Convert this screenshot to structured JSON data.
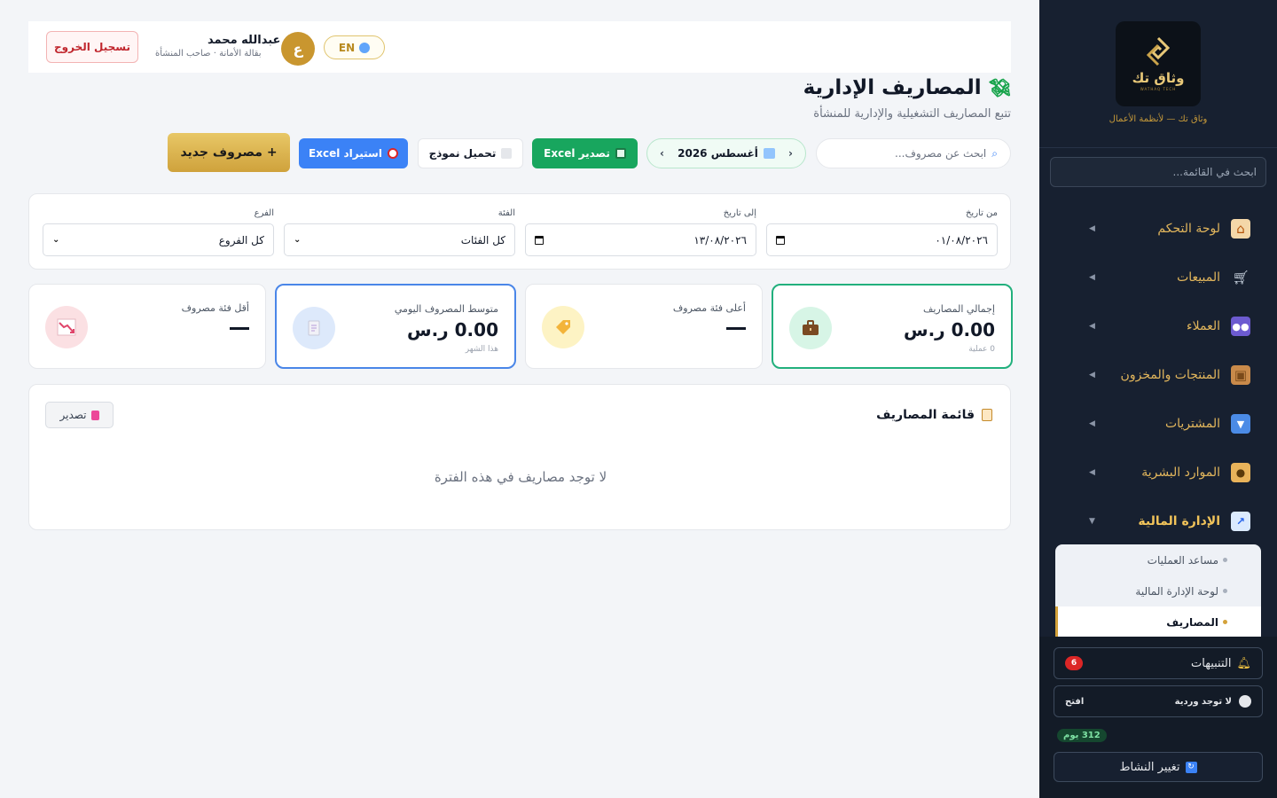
{
  "sidebar": {
    "logo_name": "وثاق تك",
    "logo_sub": "WATHAQ TECH",
    "tagline": "وثاق تك — لأنظمة الأعمال",
    "search_placeholder": "ابحث في القائمة...",
    "items": [
      {
        "label": "لوحة التحكم",
        "icon": "home-icon"
      },
      {
        "label": "المبيعات",
        "icon": "cart-icon"
      },
      {
        "label": "العملاء",
        "icon": "users-icon"
      },
      {
        "label": "المنتجات والمخزون",
        "icon": "box-icon"
      },
      {
        "label": "المشتريات",
        "icon": "inbox-icon"
      },
      {
        "label": "الموارد البشرية",
        "icon": "person-icon"
      },
      {
        "label": "الإدارة المالية",
        "icon": "chart-icon"
      }
    ],
    "submenu": [
      {
        "label": "مساعد العمليات"
      },
      {
        "label": "لوحة الإدارة المالية"
      },
      {
        "label": "المصاريف"
      }
    ],
    "notifications_label": "التنبيهات",
    "notifications_count": "6",
    "shift_label": "لا توجد وردية",
    "shift_open": "افتح",
    "days_left": "312 يوم",
    "change_activity": "تغيير النشاط"
  },
  "topbar": {
    "logout": "تسجيل الخروج",
    "user_name": "عبدالله محمد",
    "user_role": "بقالة الأمانة · صاحب المنشأة",
    "avatar_letter": "ع",
    "lang": "EN"
  },
  "page": {
    "title": "المصاريف الإدارية",
    "subtitle": "تتبع المصاريف التشغيلية والإدارية للمنشأة"
  },
  "toolbar": {
    "search_placeholder": "ابحث عن مصروف...",
    "month_label": "أغسطس 2026",
    "export_excel": "تصدير Excel",
    "download_template": "تحميل نموذج",
    "import_excel": "استيراد Excel",
    "new_expense": "+ مصروف جديد"
  },
  "filters": {
    "from_label": "من تاريخ",
    "from_value": "٠١/٠٨/٢٠٢٦",
    "to_label": "إلى تاريخ",
    "to_value": "١٣/٠٨/٢٠٢٦",
    "category_label": "الفئة",
    "category_value": "كل الفئات",
    "branch_label": "الفرع",
    "branch_value": "كل الفروع"
  },
  "stats": {
    "total": {
      "label": "إجمالي المصاريف",
      "value": "0.00 ر.س",
      "note": "0 عملية"
    },
    "top_category": {
      "label": "أعلى فئة مصروف"
    },
    "daily_avg": {
      "label": "متوسط المصروف اليومي",
      "value": "0.00 ر.س",
      "note": "هذا الشهر"
    },
    "low_category": {
      "label": "أقل فئة مصروف"
    }
  },
  "list": {
    "title": "قائمة المصاريف",
    "export": "تصدير",
    "empty": "لا توجد مصاريف في هذه الفترة"
  }
}
